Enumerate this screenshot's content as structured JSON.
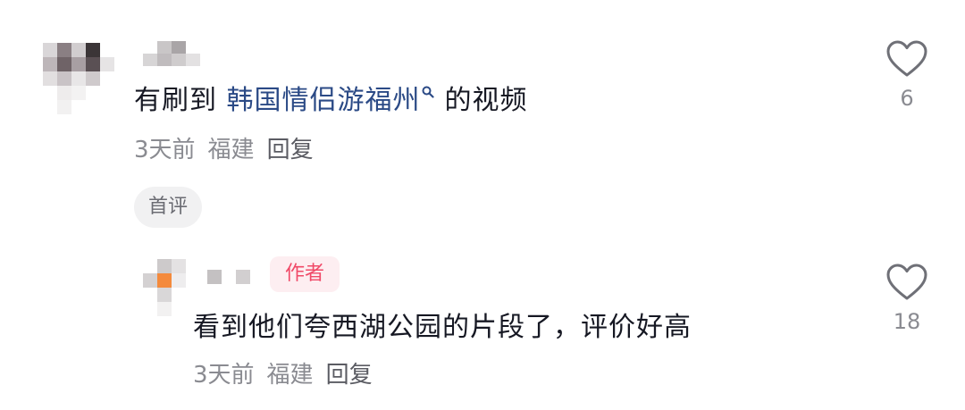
{
  "comments": [
    {
      "text_before": "有刷到 ",
      "link_text": "韩国情侣游福州",
      "text_after": "的视频",
      "time": "3天前",
      "location": "福建",
      "reply_label": "回复",
      "tag": "首评",
      "like_count": "6"
    },
    {
      "author_tag": "作者",
      "text": "看到他们夸西湖公园的片段了，评价好高",
      "time": "3天前",
      "location": "福建",
      "reply_label": "回复",
      "like_count": "18"
    }
  ],
  "colors": {
    "text": "#161823",
    "link": "#2b4a86",
    "meta": "#8a8b91",
    "author_tag_bg": "#fdeef1",
    "author_tag_text": "#f04a68"
  },
  "icons": {
    "like": "heart-outline-icon",
    "link_search": "search-icon"
  }
}
